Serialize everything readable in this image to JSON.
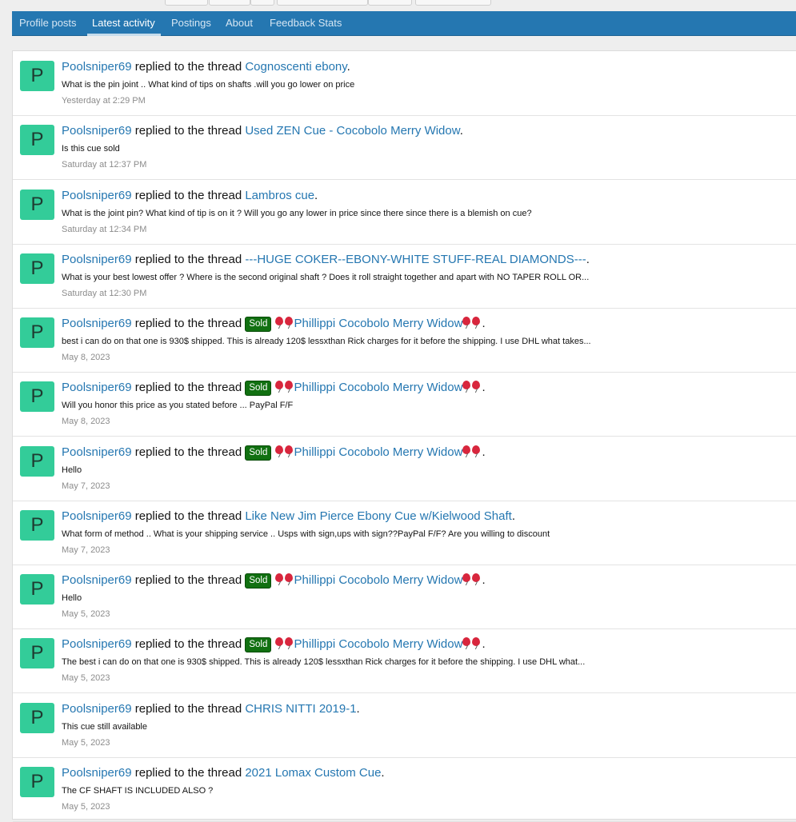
{
  "tabs": [
    {
      "label": "Profile posts",
      "active": false
    },
    {
      "label": "Latest activity",
      "active": true
    },
    {
      "label": "Postings",
      "active": false
    },
    {
      "label": "About",
      "active": false
    },
    {
      "label": "Feedback Stats",
      "active": false
    }
  ],
  "colors": {
    "tab_bar": "#2577b1",
    "link": "#2577b1",
    "avatar_bg": "#33cc99",
    "sold_badge": "#117011",
    "balloon": "#d8263d",
    "timestamp": "#8c8c8c"
  },
  "activity": [
    {
      "avatar_letter": "P",
      "user": "Poolsniper69",
      "action": " replied to the thread ",
      "sold_label": "",
      "balloons": false,
      "thread": "Cognoscenti ebony",
      "end": ".",
      "snippet": "What is the pin joint .. What kind of tips on shafts .will you go lower on price",
      "time": "Yesterday at 2:29 PM"
    },
    {
      "avatar_letter": "P",
      "user": "Poolsniper69",
      "action": " replied to the thread ",
      "sold_label": "",
      "balloons": false,
      "thread": "Used ZEN Cue - Cocobolo Merry Widow",
      "end": ".",
      "snippet": "Is this cue sold",
      "time": "Saturday at 12:37 PM"
    },
    {
      "avatar_letter": "P",
      "user": "Poolsniper69",
      "action": " replied to the thread ",
      "sold_label": "",
      "balloons": false,
      "thread": "Lambros cue",
      "end": ".",
      "snippet": "What is the joint pin? What kind of tip is on it ? Will you go any lower in price since there since there is a blemish on cue?",
      "time": "Saturday at 12:34 PM"
    },
    {
      "avatar_letter": "P",
      "user": "Poolsniper69",
      "action": " replied to the thread ",
      "sold_label": "",
      "balloons": false,
      "thread": "---HUGE COKER--EBONY-WHITE STUFF-REAL DIAMONDS---",
      "end": ".",
      "snippet": "What is your best lowest offer ? Where is the second original shaft ? Does it roll straight together and apart with NO TAPER ROLL OR...",
      "time": "Saturday at 12:30 PM"
    },
    {
      "avatar_letter": "P",
      "user": "Poolsniper69",
      "action": " replied to the thread ",
      "sold_label": "Sold",
      "balloons": true,
      "thread": "Phillippi Cocobolo Merry Widow",
      "end": ".",
      "snippet": "best i can do on that one is 930$ shipped. This is already 120$ lessxthan Rick charges for it before the shipping. I use DHL what takes...",
      "time": "May 8, 2023"
    },
    {
      "avatar_letter": "P",
      "user": "Poolsniper69",
      "action": " replied to the thread ",
      "sold_label": "Sold",
      "balloons": true,
      "thread": "Phillippi Cocobolo Merry Widow",
      "end": ".",
      "snippet": "Will you honor this price as you stated before ... PayPal F/F",
      "time": "May 8, 2023"
    },
    {
      "avatar_letter": "P",
      "user": "Poolsniper69",
      "action": " replied to the thread ",
      "sold_label": "Sold",
      "balloons": true,
      "thread": "Phillippi Cocobolo Merry Widow",
      "end": ".",
      "snippet": "Hello",
      "time": "May 7, 2023"
    },
    {
      "avatar_letter": "P",
      "user": "Poolsniper69",
      "action": " replied to the thread ",
      "sold_label": "",
      "balloons": false,
      "thread": "Like New Jim Pierce Ebony Cue w/Kielwood Shaft",
      "end": ".",
      "snippet": "What form of method .. What is your shipping service .. Usps with sign,ups with sign??PayPal F/F? Are you willing to discount",
      "time": "May 7, 2023"
    },
    {
      "avatar_letter": "P",
      "user": "Poolsniper69",
      "action": " replied to the thread ",
      "sold_label": "Sold",
      "balloons": true,
      "thread": "Phillippi Cocobolo Merry Widow",
      "end": ".",
      "snippet": "Hello",
      "time": "May 5, 2023"
    },
    {
      "avatar_letter": "P",
      "user": "Poolsniper69",
      "action": " replied to the thread ",
      "sold_label": "Sold",
      "balloons": true,
      "thread": "Phillippi Cocobolo Merry Widow",
      "end": ".",
      "snippet": "The best i can do on that one is 930$ shipped. This is already 120$ lessxthan Rick charges for it before the shipping. I use DHL what...",
      "time": "May 5, 2023"
    },
    {
      "avatar_letter": "P",
      "user": "Poolsniper69",
      "action": " replied to the thread ",
      "sold_label": "",
      "balloons": false,
      "thread": "CHRIS NITTI 2019-1",
      "end": ".",
      "snippet": "This cue still available",
      "time": "May 5, 2023"
    },
    {
      "avatar_letter": "P",
      "user": "Poolsniper69",
      "action": " replied to the thread ",
      "sold_label": "",
      "balloons": false,
      "thread": "2021 Lomax Custom Cue",
      "end": ".",
      "snippet": "The CF SHAFT IS INCLUDED ALSO ?",
      "time": "May 5, 2023"
    }
  ]
}
